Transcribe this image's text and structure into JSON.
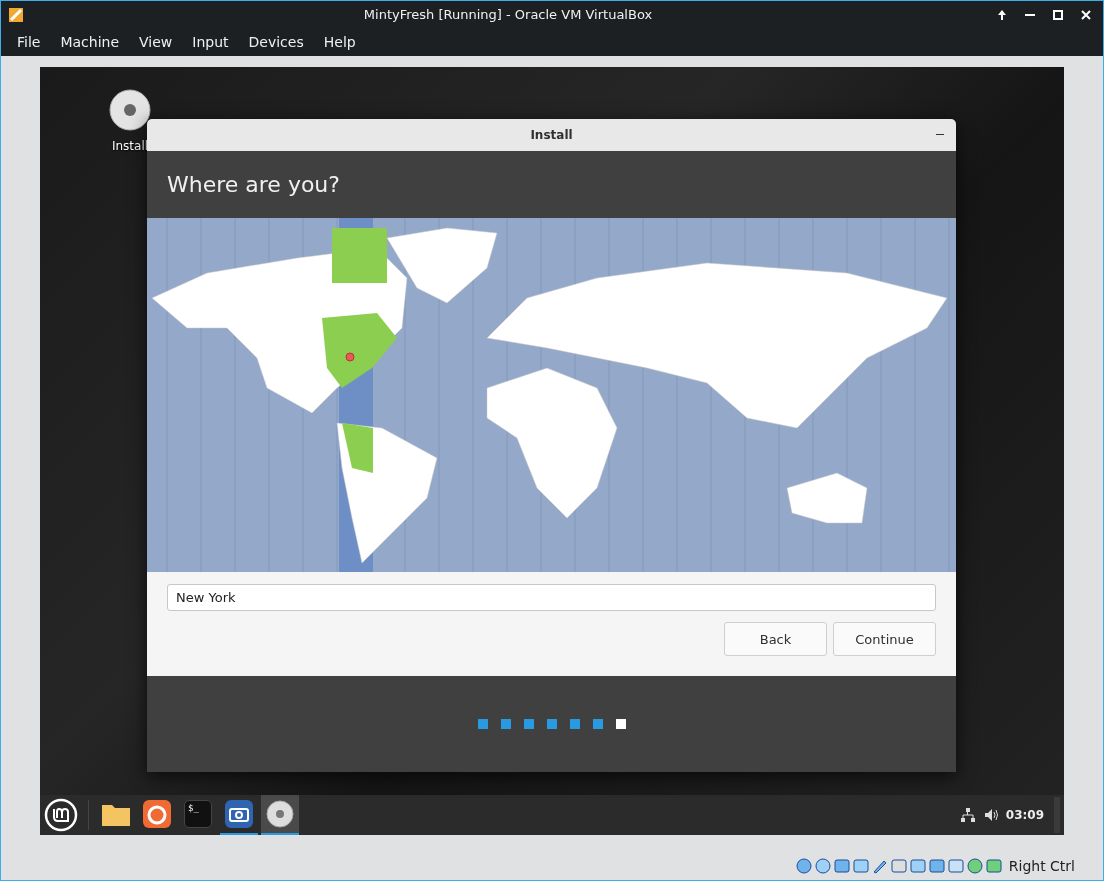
{
  "window": {
    "title": "MintyFresh [Running] - Oracle VM VirtualBox"
  },
  "menu": [
    "File",
    "Machine",
    "View",
    "Input",
    "Devices",
    "Help"
  ],
  "desktop_icon": {
    "label": "Install"
  },
  "installer": {
    "title": "Install",
    "heading": "Where are you?",
    "location": {
      "value": "New York"
    },
    "buttons": [
      "Back",
      "Continue"
    ],
    "steps": [
      {
        "selected": false
      },
      {
        "selected": false
      },
      {
        "selected": false
      },
      {
        "selected": false
      },
      {
        "selected": false
      },
      {
        "selected": false
      },
      {
        "selected": true
      }
    ]
  },
  "taskbar": {
    "apps": [
      {
        "kind": "files",
        "running": false,
        "selected": false
      },
      {
        "kind": "browser",
        "running": false,
        "selected": false
      },
      {
        "kind": "terminal",
        "glyph": "$_",
        "running": false,
        "selected": false
      },
      {
        "kind": "screenshot",
        "running": true,
        "selected": false
      },
      {
        "kind": "disc",
        "running": true,
        "selected": true
      }
    ],
    "clock": "03:09"
  },
  "status_bar": {
    "host_key": "Right Ctrl"
  }
}
